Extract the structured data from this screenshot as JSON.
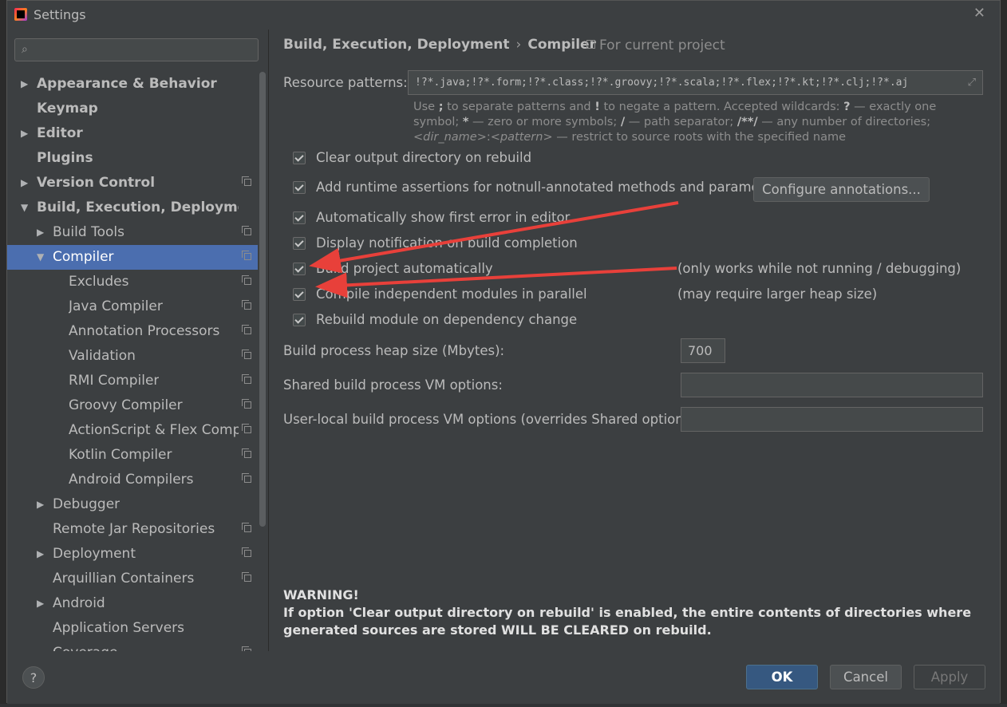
{
  "window": {
    "title": "Settings"
  },
  "search": {
    "placeholder": ""
  },
  "tree": [
    {
      "label": "Appearance & Behavior",
      "level": 0,
      "arrow": "right",
      "bold": true,
      "proj": false
    },
    {
      "label": "Keymap",
      "level": 0,
      "arrow": "",
      "bold": true,
      "proj": false
    },
    {
      "label": "Editor",
      "level": 0,
      "arrow": "right",
      "bold": true,
      "proj": false
    },
    {
      "label": "Plugins",
      "level": 0,
      "arrow": "",
      "bold": true,
      "proj": false
    },
    {
      "label": "Version Control",
      "level": 0,
      "arrow": "right",
      "bold": true,
      "proj": true
    },
    {
      "label": "Build, Execution, Deployment",
      "level": 0,
      "arrow": "down",
      "bold": true,
      "proj": false
    },
    {
      "label": "Build Tools",
      "level": 1,
      "arrow": "right",
      "bold": false,
      "proj": true
    },
    {
      "label": "Compiler",
      "level": 1,
      "arrow": "down",
      "bold": false,
      "proj": true,
      "selected": true
    },
    {
      "label": "Excludes",
      "level": 2,
      "arrow": "",
      "bold": false,
      "proj": true
    },
    {
      "label": "Java Compiler",
      "level": 2,
      "arrow": "",
      "bold": false,
      "proj": true
    },
    {
      "label": "Annotation Processors",
      "level": 2,
      "arrow": "",
      "bold": false,
      "proj": true
    },
    {
      "label": "Validation",
      "level": 2,
      "arrow": "",
      "bold": false,
      "proj": true
    },
    {
      "label": "RMI Compiler",
      "level": 2,
      "arrow": "",
      "bold": false,
      "proj": true
    },
    {
      "label": "Groovy Compiler",
      "level": 2,
      "arrow": "",
      "bold": false,
      "proj": true
    },
    {
      "label": "ActionScript & Flex Compile",
      "level": 2,
      "arrow": "",
      "bold": false,
      "proj": true
    },
    {
      "label": "Kotlin Compiler",
      "level": 2,
      "arrow": "",
      "bold": false,
      "proj": true
    },
    {
      "label": "Android Compilers",
      "level": 2,
      "arrow": "",
      "bold": false,
      "proj": true
    },
    {
      "label": "Debugger",
      "level": 1,
      "arrow": "right",
      "bold": false,
      "proj": false
    },
    {
      "label": "Remote Jar Repositories",
      "level": 1,
      "arrow": "",
      "bold": false,
      "proj": true
    },
    {
      "label": "Deployment",
      "level": 1,
      "arrow": "right",
      "bold": false,
      "proj": true
    },
    {
      "label": "Arquillian Containers",
      "level": 1,
      "arrow": "",
      "bold": false,
      "proj": true
    },
    {
      "label": "Android",
      "level": 1,
      "arrow": "right",
      "bold": false,
      "proj": false
    },
    {
      "label": "Application Servers",
      "level": 1,
      "arrow": "",
      "bold": false,
      "proj": false
    },
    {
      "label": "Coverage",
      "level": 1,
      "arrow": "",
      "bold": false,
      "proj": true
    }
  ],
  "breadcrumb": {
    "parent": "Build, Execution, Deployment",
    "separator": "›",
    "current": "Compiler"
  },
  "scope_note": "For current project",
  "resource_patterns": {
    "label": "Resource patterns:",
    "value": "!?*.java;!?*.form;!?*.class;!?*.groovy;!?*.scala;!?*.flex;!?*.kt;!?*.clj;!?*.aj"
  },
  "hint": {
    "p1": "Use ",
    "sep": ";",
    "p2": " to separate patterns and ",
    "neg": "!",
    "p3": " to negate a pattern. Accepted wildcards: ",
    "q": "?",
    "p4": " — exactly one symbol; ",
    "star": "*",
    "p5": " — zero or more symbols; ",
    "slash": "/",
    "p6": " — path separator; ",
    "dstar": "/**/",
    "p7": " — any number of directories; ",
    "dir": "<dir_name>",
    "colon": ":",
    "pattern": "<pattern>",
    "p8": " — restrict to source roots with the specified name"
  },
  "options": {
    "clear_output": "Clear output directory on rebuild",
    "runtime_assertions": "Add runtime assertions for notnull-annotated methods and parameters",
    "show_first_error": "Automatically show first error in editor",
    "display_notification": "Display notification on build completion",
    "build_auto": "Build project automatically",
    "build_auto_note": "(only works while not running / debugging)",
    "parallel": "Compile independent modules in parallel",
    "parallel_note": "(may require larger heap size)",
    "rebuild_module": "Rebuild module on dependency change"
  },
  "configure_button": "Configure annotations...",
  "heap": {
    "label": "Build process heap size (Mbytes):",
    "value": "700"
  },
  "shared_vm": {
    "label": "Shared build process VM options:",
    "value": ""
  },
  "user_vm": {
    "label": "User-local build process VM options (overrides Shared options):",
    "value": ""
  },
  "warning": {
    "title": "WARNING!",
    "body": "If option 'Clear output directory on rebuild' is enabled, the entire contents of directories where generated sources are stored WILL BE CLEARED on rebuild."
  },
  "buttons": {
    "help": "?",
    "ok": "OK",
    "cancel": "Cancel",
    "apply": "Apply"
  },
  "colors": {
    "annotation_arrow": "#e8403a",
    "selection": "#4b6eaf"
  }
}
